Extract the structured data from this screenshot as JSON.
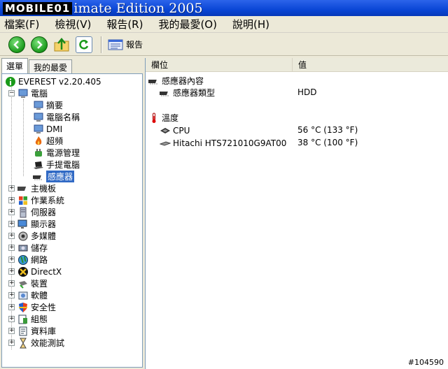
{
  "window": {
    "logo_text": "MOBILE01",
    "title": "imate Edition 2005"
  },
  "menu": [
    "檔案(F)",
    "檢視(V)",
    "報告(R)",
    "我的最愛(O)",
    "說明(H)"
  ],
  "toolbar": {
    "report_label": "報告"
  },
  "tabs": [
    "選單",
    "我的最愛"
  ],
  "tree": {
    "root": "EVEREST v2.20.405",
    "computer": "電腦",
    "computer_children": [
      "摘要",
      "電腦名稱",
      "DMI",
      "超頻",
      "電源管理",
      "手提電腦",
      "感應器"
    ],
    "top_level": [
      "主機板",
      "作業系統",
      "伺服器",
      "顯示器",
      "多媒體",
      "儲存",
      "網路",
      "DirectX",
      "裝置",
      "軟體",
      "安全性",
      "組態",
      "資料庫",
      "效能測試"
    ]
  },
  "list": {
    "columns": [
      "欄位",
      "值"
    ],
    "group1": "感應器內容",
    "sensor_type_label": "感應器類型",
    "sensor_type_value": "HDD",
    "group2": "溫度",
    "cpu_label": "CPU",
    "cpu_value": "56 °C (133 °F)",
    "hdd_label": "Hitachi HTS721010G9AT00",
    "hdd_value": "38 °C (100 °F)"
  },
  "footer": {
    "id": "#104590"
  }
}
